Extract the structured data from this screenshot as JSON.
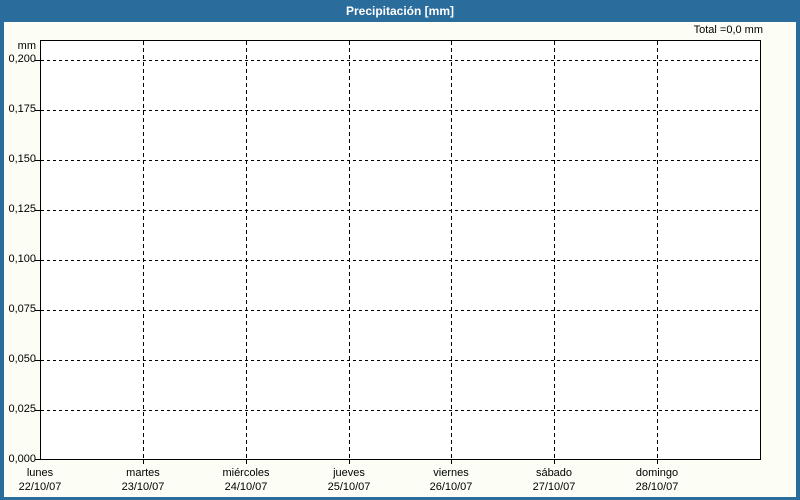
{
  "window": {
    "title": "Precipitación [mm]"
  },
  "header": {
    "total_label": "Total =0,0 mm"
  },
  "colors": {
    "header_bg": "#2a6c9c",
    "frame_border": "#2a6c9c",
    "page_bg": "#fcfdf4",
    "plot_bg": "#ffffff",
    "grid": "#000000",
    "title_text": "#ffffff",
    "label_text": "#000000"
  },
  "chart_data": {
    "type": "bar",
    "title": "Precipitación [mm]",
    "unit_label": "mm",
    "ylabel": "mm",
    "ylim": [
      0,
      0.21
    ],
    "y_tick_step": 0.025,
    "y_ticks": [
      "0,200",
      "0,175",
      "0,150",
      "0,125",
      "0,100",
      "0,075",
      "0,050",
      "0,025",
      "0,000"
    ],
    "y_tick_values": [
      0.2,
      0.175,
      0.15,
      0.125,
      0.1,
      0.075,
      0.05,
      0.025,
      0.0
    ],
    "categories": [
      {
        "day": "lunes",
        "date": "22/10/07"
      },
      {
        "day": "martes",
        "date": "23/10/07"
      },
      {
        "day": "miércoles",
        "date": "24/10/07"
      },
      {
        "day": "jueves",
        "date": "25/10/07"
      },
      {
        "day": "viernes",
        "date": "26/10/07"
      },
      {
        "day": "sábado",
        "date": "27/10/07"
      },
      {
        "day": "domingo",
        "date": "28/10/07"
      }
    ],
    "values": [
      0,
      0,
      0,
      0,
      0,
      0,
      0
    ],
    "total": 0.0,
    "total_display": "Total =0,0 mm",
    "grid": "dashed",
    "legend": "none"
  }
}
